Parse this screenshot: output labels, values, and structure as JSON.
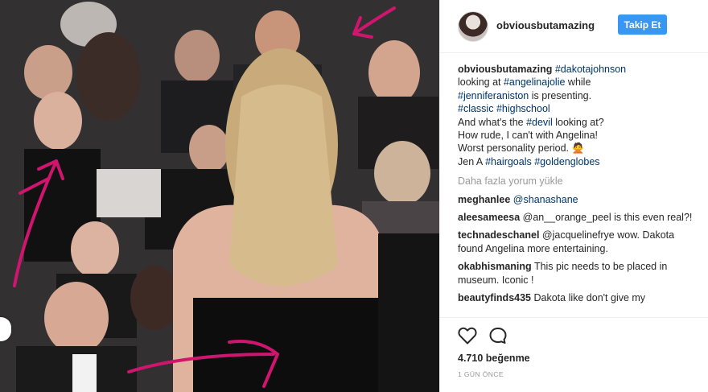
{
  "post": {
    "username": "obviousbutamazing",
    "follow_label": "Takip Et"
  },
  "caption": {
    "user": "obviousbutamazing",
    "l1_tag": "#dakotajohnson",
    "l2_pre": "looking at ",
    "l2_tag": "#angelinajolie",
    "l2_post": " while",
    "l3_tag": "#jenniferaniston",
    "l3_post": " is presenting.",
    "l4_tag1": "#classic",
    "l4_tag2": "#highschool",
    "l5_pre": "And what's the ",
    "l5_tag": "#devil",
    "l5_post": " looking at?",
    "l6": "How rude, I can't with Angelina!",
    "l7": "Worst personality period. 🙅",
    "l8_pre": "Jen A ",
    "l8_tag1": "#hairgoals",
    "l8_tag2": "#goldenglobes"
  },
  "load_more": "Daha fazla yorum yükle",
  "comments": [
    {
      "user": "meghanlee",
      "text": "@shanashane"
    },
    {
      "user": "aleesameesa",
      "text": "@an__orange_peel is this even real?!"
    },
    {
      "user": "technadeschanel",
      "text": "@jacquelinefrye wow. Dakota found Angelina more entertaining."
    },
    {
      "user": "okabhismaning",
      "text": "This pic needs to be placed in museum. Iconic !"
    },
    {
      "user": "beautyfinds435",
      "text": "Dakota like don't give my"
    }
  ],
  "likes": "4.710 beğenme",
  "time": "1 GÜN ÖNCE",
  "icons": {
    "like": "heart-icon",
    "comment": "comment-icon"
  },
  "colors": {
    "follow_button": "#3897f0",
    "hashtag": "#003569",
    "annotation_arrows": "#d0156f"
  }
}
